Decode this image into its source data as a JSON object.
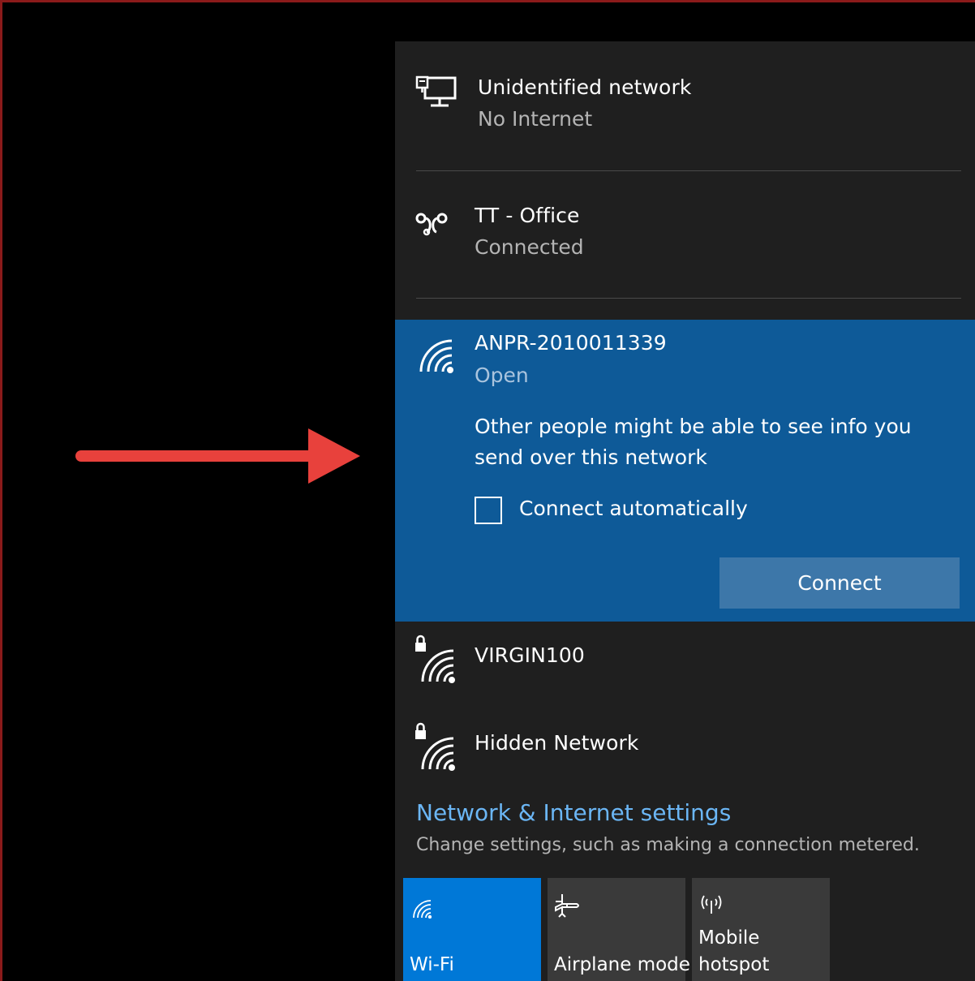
{
  "networks": [
    {
      "name": "Unidentified network",
      "status": "No Internet",
      "icon": "ethernet-monitor-icon"
    },
    {
      "name": "TT - Office",
      "status": "Connected",
      "icon": "dialup-vpn-icon"
    },
    {
      "name": "ANPR-2010011339",
      "status": "Open",
      "icon": "wifi-signal-icon"
    },
    {
      "name": "VIRGIN100",
      "icon": "wifi-secured-icon"
    },
    {
      "name": "Hidden Network",
      "icon": "wifi-secured-icon"
    }
  ],
  "selected_network": {
    "warning": "Other people might be able to see info you send over this network",
    "auto_connect_label": "Connect automatically",
    "auto_connect_checked": false,
    "connect_button": "Connect"
  },
  "settings": {
    "link": "Network & Internet settings",
    "description": "Change settings, such as making a connection metered."
  },
  "quick_actions": [
    {
      "label": "Wi-Fi",
      "icon": "wifi-icon",
      "active": true
    },
    {
      "label": "Airplane mode",
      "icon": "airplane-icon",
      "active": false
    },
    {
      "label_line1": "Mobile",
      "label_line2": "hotspot",
      "icon": "hotspot-icon",
      "active": false
    }
  ],
  "colors": {
    "selected_bg": "#0e5a98",
    "active_tile": "#0078d7",
    "link": "#6bb6f5",
    "arrow": "#e8413c"
  }
}
